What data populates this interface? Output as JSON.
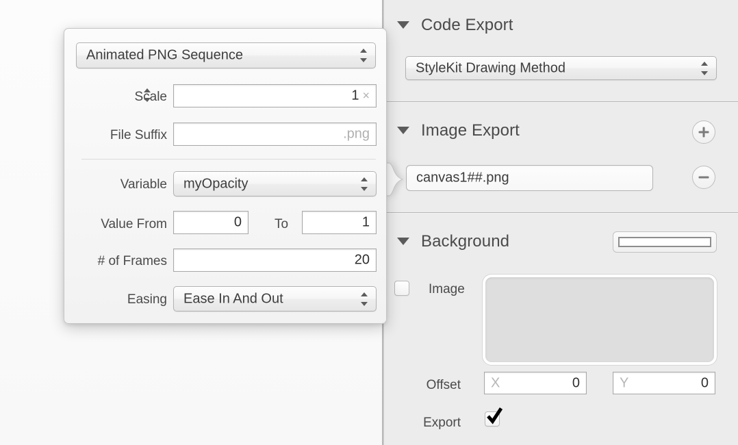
{
  "window": {
    "app_context": "export-settings-inspector"
  },
  "popover": {
    "format_popup": {
      "value": "Animated PNG Sequence",
      "icon": "chevron-updown-icon"
    },
    "rows": [
      {
        "label": "Scale",
        "value": "1",
        "unit": "×",
        "has_stepper": true
      },
      {
        "label": "File Suffix",
        "value": "",
        "placeholder_right": ".png"
      }
    ],
    "scale_label": "Scale",
    "scale_value": "1",
    "scale_unit": "×",
    "file_suffix_label": "File Suffix",
    "file_suffix_value": ".png",
    "variable_label": "Variable",
    "variable_value": "myOpacity",
    "value_from_label": "Value From",
    "value_from": "0",
    "to_label": "To",
    "value_to": "1",
    "frames_label": "# of Frames",
    "frames_value": "20",
    "easing_label": "Easing",
    "easing_value": "Ease In And Out"
  },
  "inspector": {
    "code_export": {
      "title": "Code Export",
      "disclosure": "triangle-down-icon",
      "method_popup": "StyleKit Drawing Method"
    },
    "image_export": {
      "title": "Image Export",
      "disclosure": "triangle-down-icon",
      "add_button": "+",
      "remove_button": "−",
      "filename": "canvas1##.png"
    },
    "background": {
      "title": "Background",
      "disclosure": "triangle-down-icon",
      "color_swatch": "#ffffff",
      "image_label": "Image",
      "image_checked": false,
      "offset_label": "Offset",
      "offset_x_placeholder": "X",
      "offset_x": "0",
      "offset_y_placeholder": "Y",
      "offset_y": "0",
      "export_label": "Export",
      "export_checked": true
    }
  },
  "colors": {
    "panel_bg": "#ececec",
    "canvas_bg": "#fafafa",
    "text": "#4a4a4a",
    "separator": "#b6b6b6"
  }
}
